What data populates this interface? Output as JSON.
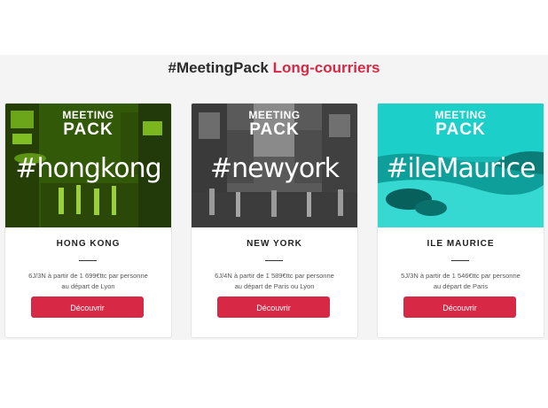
{
  "section": {
    "title_prefix": "#MeetingPack",
    "title_accent": "Long-courriers"
  },
  "colors": {
    "accent": "#d72845",
    "hongkong_tint": "#4f8a10",
    "newyork_tint": "#555555",
    "maurice_tint": "#1cc7c0"
  },
  "badge": {
    "line1": "MEETING",
    "line2": "PACK"
  },
  "cards": [
    {
      "hashtag": "#hongkong",
      "title": "HONG KONG",
      "desc_line1": "6J/3N à partir de 1 699€ttc par personne",
      "desc_line2": "au départ de Lyon",
      "button": "Découvrir"
    },
    {
      "hashtag": "#newyork",
      "title": "NEW YORK",
      "desc_line1": "6J/4N à partir de 1 589€ttc par personne",
      "desc_line2": "au départ de Paris ou Lyon",
      "button": "Découvrir"
    },
    {
      "hashtag": "#ileMaurice",
      "title": "ILE MAURICE",
      "desc_line1": "5J/3N à partir de 1 546€ttc par personne",
      "desc_line2": "au départ de Paris",
      "button": "Découvrir"
    }
  ]
}
